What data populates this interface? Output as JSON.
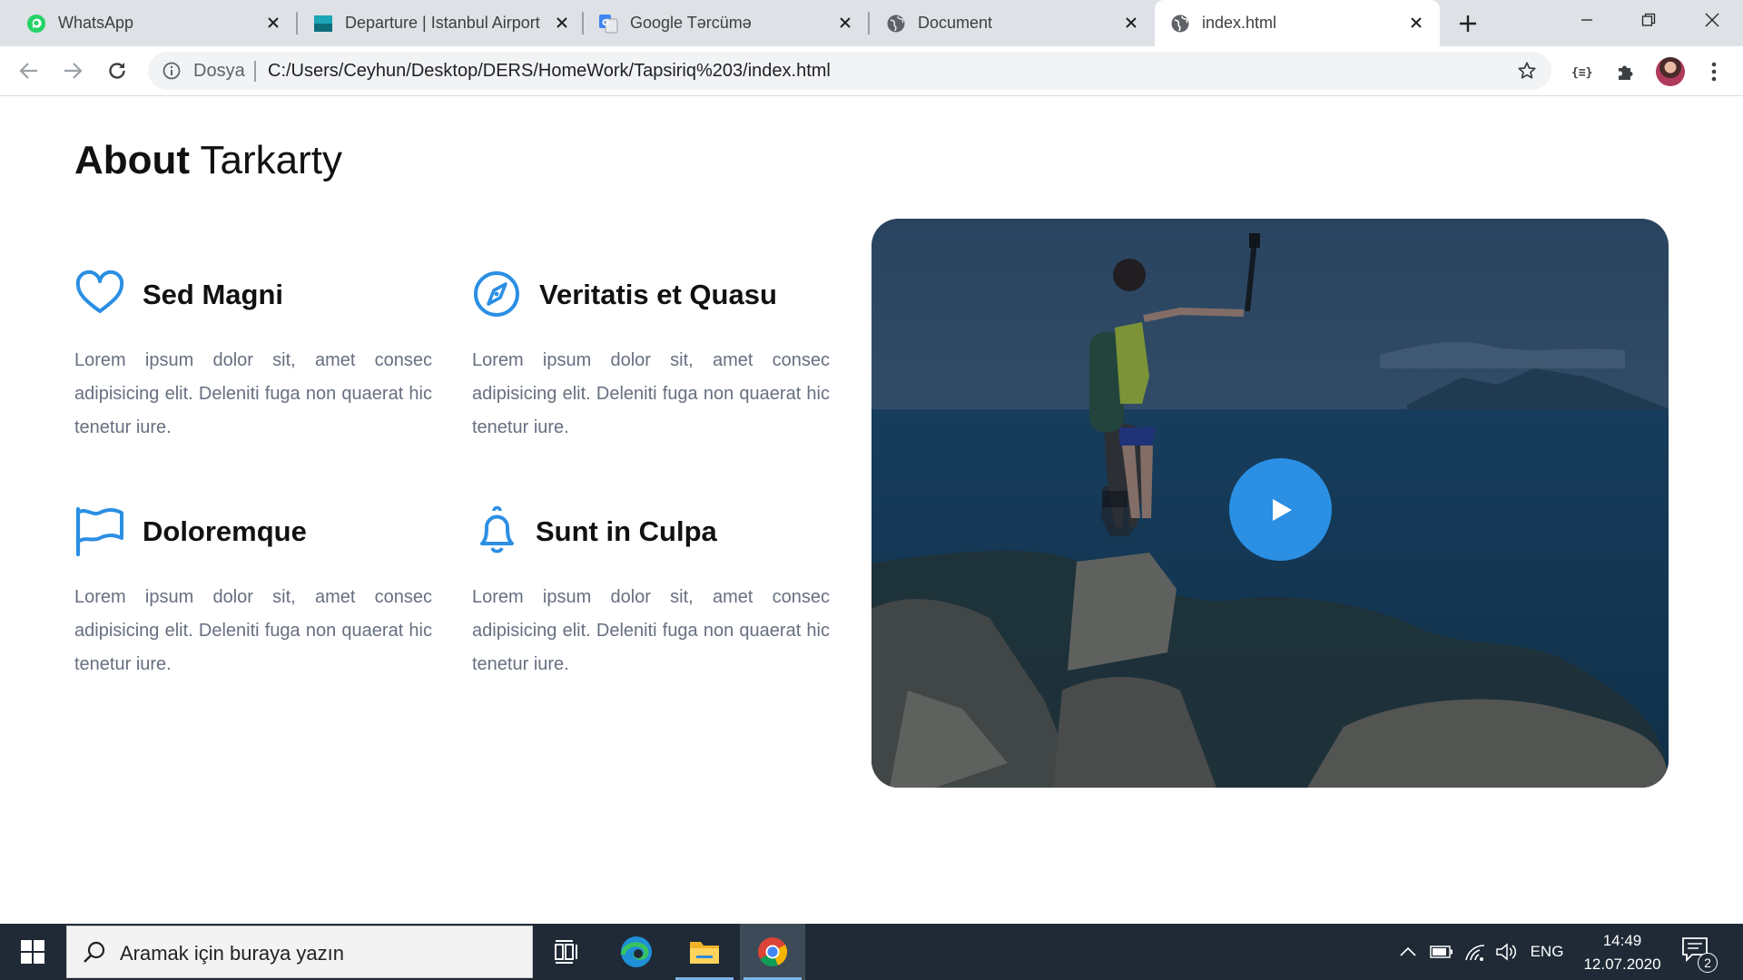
{
  "browser": {
    "tabs": [
      {
        "title": "WhatsApp",
        "icon": "whatsapp-icon"
      },
      {
        "title": "Departure | Istanbul Airport",
        "icon": "istanbul-airport-icon"
      },
      {
        "title": "Google Tərcümə",
        "icon": "google-translate-icon"
      },
      {
        "title": "Document",
        "icon": "globe-icon"
      },
      {
        "title": "index.html",
        "icon": "globe-icon"
      }
    ],
    "address": {
      "scheme_label": "Dosya",
      "url": "C:/Users/Ceyhun/Desktop/DERS/HomeWork/Tapsiriq%203/index.html"
    }
  },
  "page": {
    "heading_bold": "About",
    "heading_rest": " Tarkarty",
    "features": [
      {
        "title": "Sed Magni",
        "icon": "heart-icon",
        "description": "Lorem ipsum dolor sit, amet consec adipisicing elit. Deleniti fuga non quaerat hic tenetur iure."
      },
      {
        "title": "Veritatis et Quasu",
        "icon": "compass-icon",
        "description": "Lorem ipsum dolor sit, amet consec adipisicing elit. Deleniti fuga non quaerat hic tenetur iure."
      },
      {
        "title": "Doloremque",
        "icon": "flag-icon",
        "description": "Lorem ipsum dolor sit, amet consec adipisicing elit. Deleniti fuga non quaerat hic tenetur iure."
      },
      {
        "title": "Sunt in Culpa",
        "icon": "bell-icon",
        "description": "Lorem ipsum dolor sit, amet consec adipisicing elit. Deleniti fuga non quaerat hic tenetur iure."
      }
    ],
    "accent_color": "#2b8fe3"
  },
  "taskbar": {
    "search_placeholder": "Aramak için buraya yazın",
    "language": "ENG",
    "time": "14:49",
    "date": "12.07.2020",
    "notification_count": "2"
  }
}
